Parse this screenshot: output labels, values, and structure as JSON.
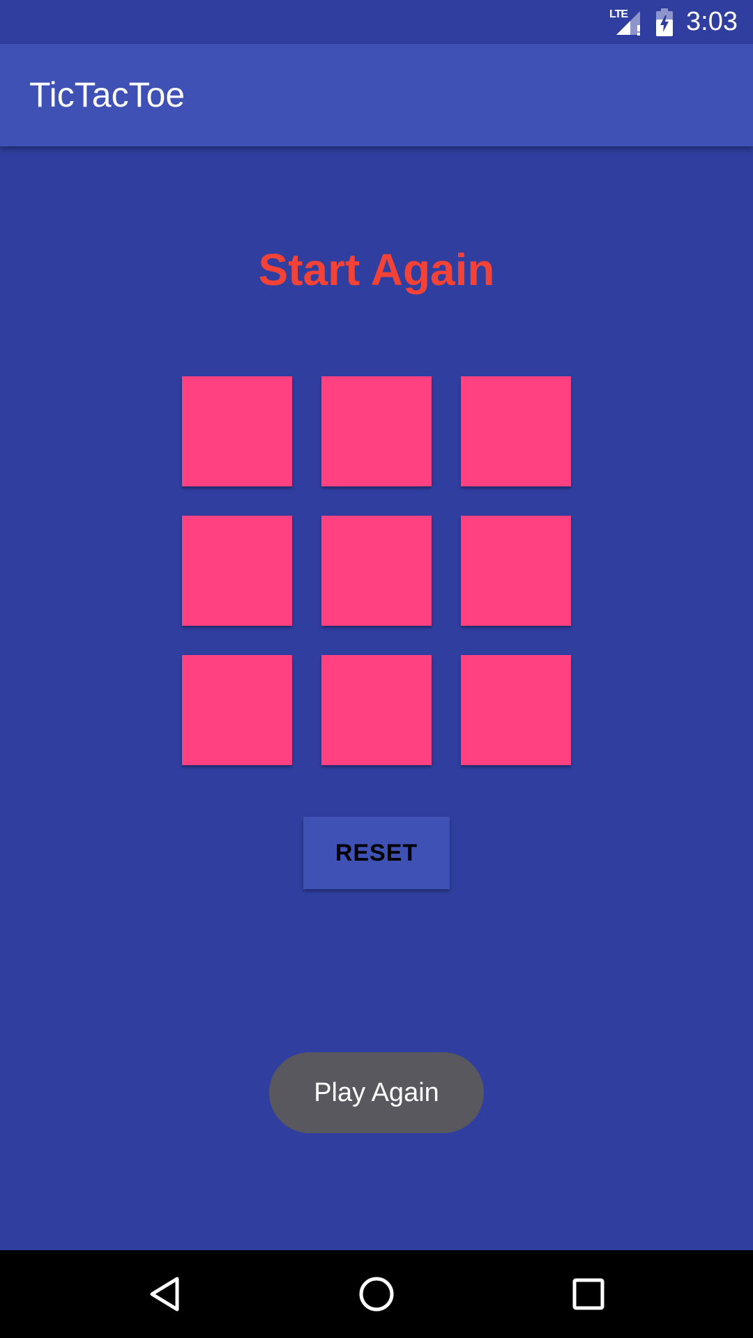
{
  "status_bar": {
    "network": "LTE",
    "time": "3:03"
  },
  "app_bar": {
    "title": "TicTacToe"
  },
  "game": {
    "status_message": "Start Again",
    "board": [
      "",
      "",
      "",
      "",
      "",
      "",
      "",
      "",
      ""
    ],
    "reset_label": "RESET"
  },
  "toast": {
    "message": "Play Again"
  },
  "nav_bar": {
    "buttons": [
      "back",
      "home",
      "recents"
    ]
  },
  "colors": {
    "primary_dark": "#303F9F",
    "primary": "#3F51B5",
    "accent": "#FF4081",
    "status_text": "#F44336",
    "toast_bg": "#58585E"
  }
}
